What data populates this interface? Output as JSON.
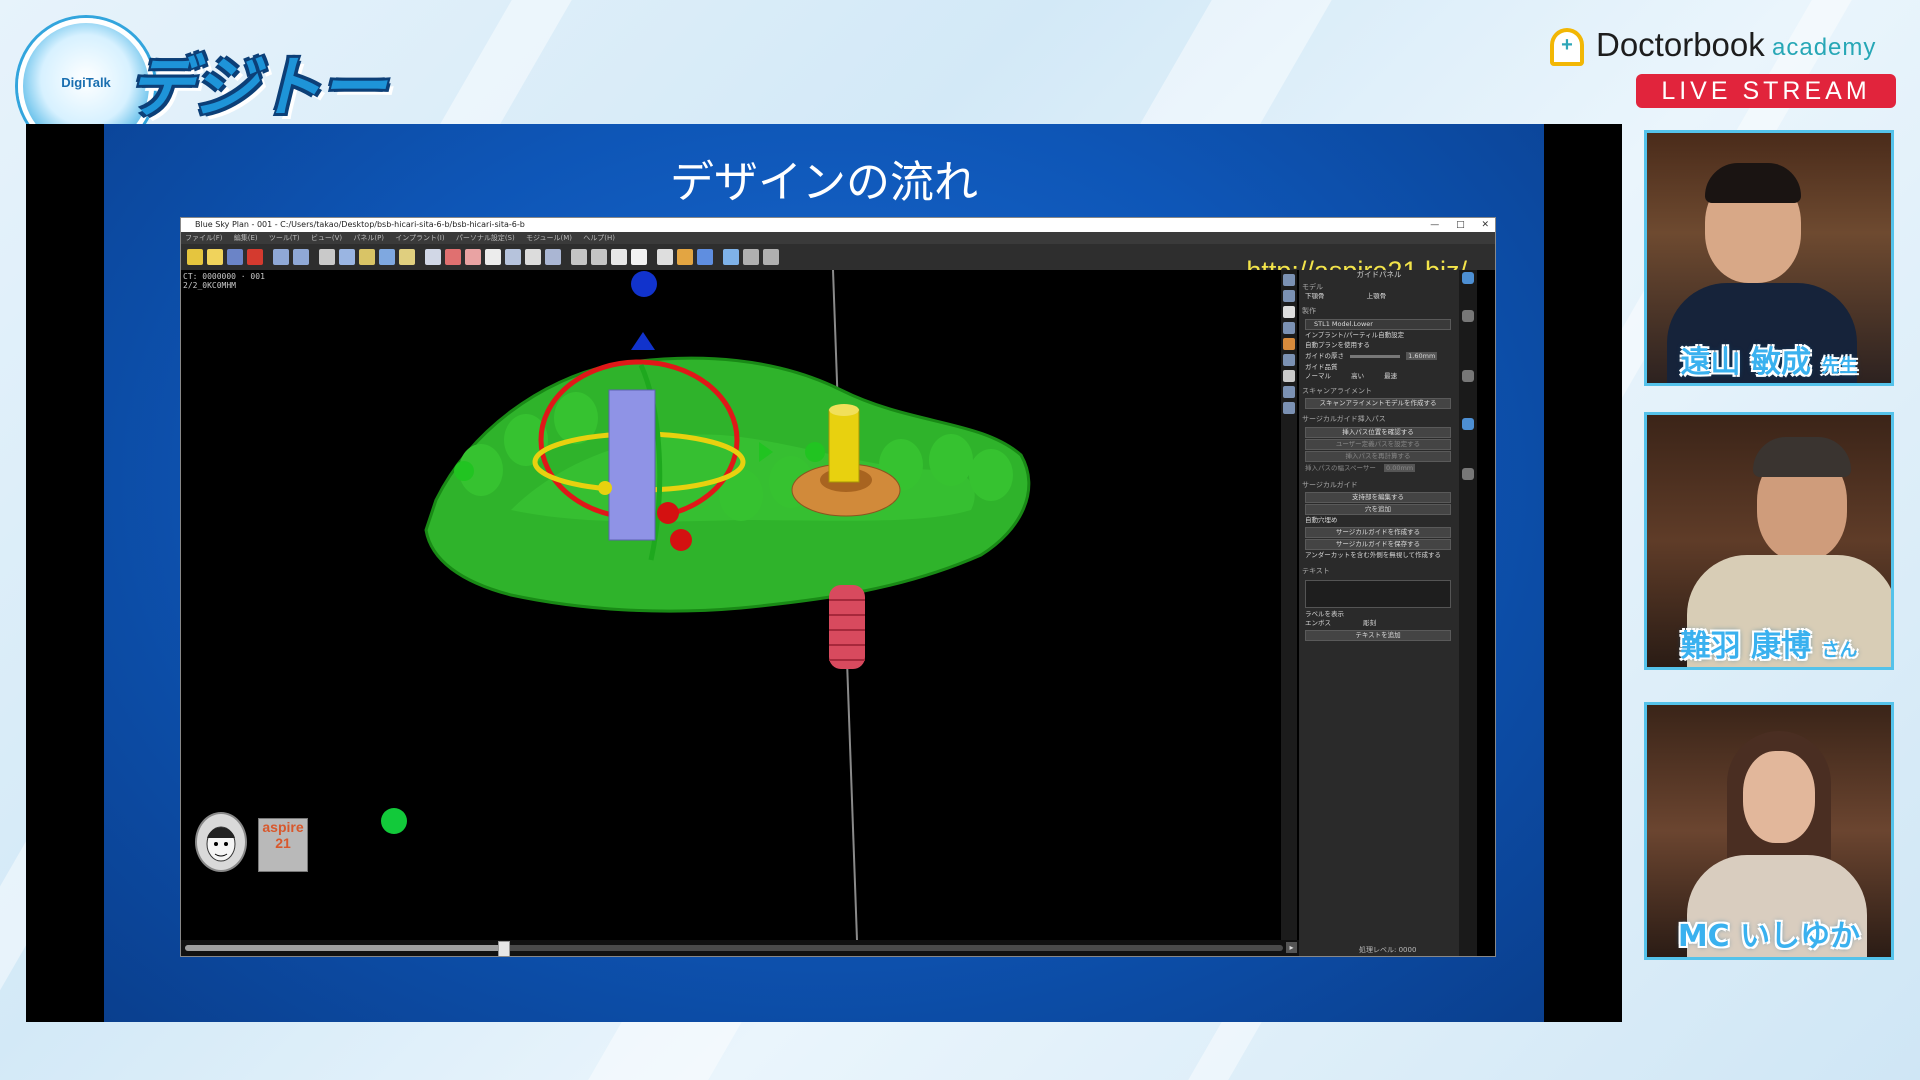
{
  "logo": {
    "badge": "DigiTalk",
    "title": "デジトーク!"
  },
  "brand": {
    "name": "Doctorbook",
    "sub": "academy",
    "live": "LIVE STREAM"
  },
  "slide": {
    "title": "デザインの流れ"
  },
  "app": {
    "window_title": "Blue Sky Plan - 001 - C:/Users/takao/Desktop/bsb-hicari-sita-6-b/bsb-hicari-sita-6-b",
    "controls": [
      "—",
      "□",
      "✕"
    ],
    "menu": [
      "ファイル(F)",
      "編集(E)",
      "ツール(T)",
      "ビュー(V)",
      "パネル(P)",
      "インプラント(I)",
      "パーソナル設定(S)",
      "モジュール(M)",
      "ヘルプ(H)"
    ],
    "url": "http://aspire21.biz/",
    "viewport_info": [
      "CT: 0000000 · 001",
      "2/2_0KC0MHM"
    ],
    "scroll_progress": 0.29,
    "panel": {
      "title": "ガイドパネル",
      "model_header": "モデル",
      "model_lower": "下顎骨",
      "model_upper": "上顎骨",
      "make_header": "製作",
      "model_select": "STL1 Model.Lower",
      "opt_implant": "インプラント/パーティル自動設定",
      "opt_auto": "自動プランを使用する",
      "thickness_label": "ガイドの厚さ",
      "thickness_value": "1.60mm",
      "guide_label": "ガイド品質",
      "quality_opts": [
        "ノーマル",
        "高い",
        "最速"
      ],
      "scan_header": "スキャンアライメント",
      "scan_btn": "スキャンアライメントモデルを作成する",
      "sleeve_header": "サージカルガイド挿入パス",
      "sleeve_btn1": "挿入パス位置を確認する",
      "sleeve_btn2": "ユーザー定義パスを設定する",
      "sleeve_btn3": "挿入パスを再計算する",
      "sleeve_row": "挿入パスの幅スペーサー",
      "sleeve_value": "0.00mm",
      "surgical_header": "サージカルガイド",
      "surgical_btn1": "支持部を編集する",
      "surgical_btn2": "穴を追加",
      "auto_fill": "自動穴埋め",
      "surgical_btn3": "サージカルガイドを作成する",
      "surgical_btn4": "サージカルガイドを保存する",
      "surgical_note": "アンダーカットを含む外側を無視して作成する",
      "text_header": "テキスト",
      "text_label": "ラベルを表示",
      "text_opts": [
        "エンボス",
        "彫刻"
      ],
      "text_btn": "テキストを追加",
      "status": "処理レベル: 0000"
    }
  },
  "avatar2_text": "aspire 21",
  "speakers": [
    {
      "name": "遠山 敏成",
      "honorific": "先生"
    },
    {
      "name": "難羽 康博",
      "honorific": "さん"
    },
    {
      "name": "MC いしゆか",
      "honorific": ""
    }
  ],
  "colors": {
    "accent_blue": "#1e94d8",
    "live_red": "#e1243c",
    "model_green": "#2fb32b"
  }
}
